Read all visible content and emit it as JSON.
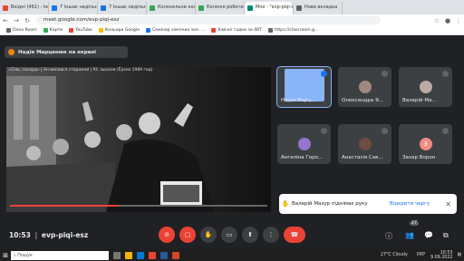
{
  "browser": {
    "tabs": [
      {
        "label": "Вхідні (461) - tettiana.pro",
        "color": "#ea4335"
      },
      {
        "label": "7 Іншає недільнаії гибо",
        "color": "#1a73e8"
      },
      {
        "label": "7 Іншає недільнаїт гибо",
        "color": "#1a73e8"
      },
      {
        "label": "Колонельни кольоризна",
        "color": "#34a853"
      },
      {
        "label": "Колонія роботи для вправ",
        "color": "#34a853"
      },
      {
        "label": "Міні - \"evp-piqi-esz\"",
        "color": "#00897b",
        "active": true
      },
      {
        "label": "Нова вкладка",
        "color": "#5f6368"
      }
    ],
    "url": "meet.google.com/evp-piqi-esz",
    "bookmarks": [
      {
        "label": "Олха Room",
        "color": "#5f6368"
      },
      {
        "label": "Карти",
        "color": "#34a853"
      },
      {
        "label": "YouTube",
        "color": "#ea4335"
      },
      {
        "label": "Кольори Google",
        "color": "#fbbc04"
      },
      {
        "label": "Семінар хімічних зол. ...",
        "color": "#1a73e8"
      },
      {
        "label": "Хімічні гадки за 48Т",
        "color": "#ea4335"
      },
      {
        "label": "https://classroom.g...",
        "color": "#5f6368"
      }
    ]
  },
  "meet": {
    "presenter_banner": "Надія Марценюк на екрані",
    "video_title": "«Сіль, сосорд» | ён вилався старамей | Rt. зыхали (Ёрсиz 1989 год)",
    "participants": [
      {
        "name": "Надія Марц...",
        "avatar_color": "#8ab4f8",
        "speaking": true
      },
      {
        "name": "Олександра Я...",
        "avatar_color": "#a1887f"
      },
      {
        "name": "Валерій Ма...",
        "avatar_color": "#bcaaa4"
      },
      {
        "name": "Ангеліна Горо...",
        "avatar_color": "#9575cd"
      },
      {
        "name": "Анастасія Сав...",
        "avatar_color": "#6d4c41"
      },
      {
        "name": "Захар Ворон",
        "avatar_color": "#f28b82",
        "initial": "З"
      }
    ],
    "toast": {
      "message": "Валерій Мазур піднімає руку",
      "queue_label": "Відкрити чергу"
    },
    "meeting_time": "10:53",
    "meeting_code": "evp-piqi-esz",
    "participant_count": "27"
  },
  "taskbar": {
    "search_placeholder": "Пошук",
    "weather": "27°C Cloudy",
    "lang": "УКР",
    "clock": "10:53",
    "date": "9.09.2022"
  }
}
